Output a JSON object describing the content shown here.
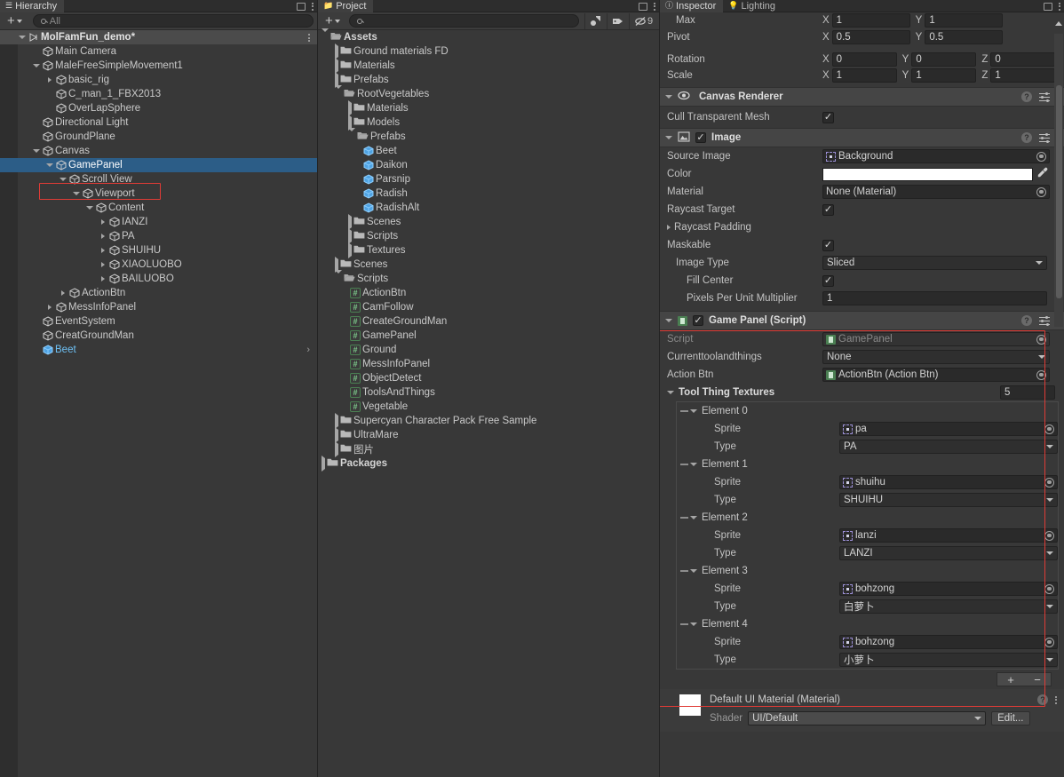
{
  "hierarchy": {
    "tab_label": "Hierarchy",
    "tab_icon": "hierarchy-icon",
    "create_label": "+",
    "search_placeholder": "All",
    "search_value": "",
    "scene_name": "MolFamFun_demo*",
    "items": [
      {
        "label": "Main Camera",
        "depth": 2,
        "tri": "none",
        "icon": "gameobject"
      },
      {
        "label": "MaleFreeSimpleMovement1",
        "depth": 2,
        "tri": "down",
        "icon": "gameobject"
      },
      {
        "label": "basic_rig",
        "depth": 3,
        "tri": "right",
        "icon": "gameobject"
      },
      {
        "label": "C_man_1_FBX2013",
        "depth": 3,
        "tri": "none",
        "icon": "gameobject"
      },
      {
        "label": "OverLapSphere",
        "depth": 3,
        "tri": "none",
        "icon": "gameobject"
      },
      {
        "label": "Directional Light",
        "depth": 2,
        "tri": "none",
        "icon": "gameobject"
      },
      {
        "label": "GroundPlane",
        "depth": 2,
        "tri": "none",
        "icon": "gameobject"
      },
      {
        "label": "Canvas",
        "depth": 2,
        "tri": "down",
        "icon": "gameobject"
      },
      {
        "label": "GamePanel",
        "depth": 3,
        "tri": "down",
        "icon": "gameobject",
        "selected": true
      },
      {
        "label": "Scroll View",
        "depth": 4,
        "tri": "down",
        "icon": "gameobject"
      },
      {
        "label": "Viewport",
        "depth": 5,
        "tri": "down",
        "icon": "gameobject"
      },
      {
        "label": "Content",
        "depth": 6,
        "tri": "down",
        "icon": "gameobject"
      },
      {
        "label": "IANZI",
        "depth": 7,
        "tri": "right",
        "icon": "gameobject"
      },
      {
        "label": "PA",
        "depth": 7,
        "tri": "right",
        "icon": "gameobject"
      },
      {
        "label": "SHUIHU",
        "depth": 7,
        "tri": "right",
        "icon": "gameobject"
      },
      {
        "label": "XIAOLUOBO",
        "depth": 7,
        "tri": "right",
        "icon": "gameobject"
      },
      {
        "label": "BAILUOBO",
        "depth": 7,
        "tri": "right",
        "icon": "gameobject"
      },
      {
        "label": "ActionBtn",
        "depth": 4,
        "tri": "right",
        "icon": "gameobject"
      },
      {
        "label": "MessInfoPanel",
        "depth": 3,
        "tri": "right",
        "icon": "gameobject"
      },
      {
        "label": "EventSystem",
        "depth": 2,
        "tri": "none",
        "icon": "gameobject"
      },
      {
        "label": "CreatGroundMan",
        "depth": 2,
        "tri": "none",
        "icon": "gameobject"
      },
      {
        "label": "Beet",
        "depth": 2,
        "tri": "none",
        "icon": "prefab",
        "prefab": true,
        "arrow": ">"
      }
    ]
  },
  "project": {
    "tab_label": "Project",
    "tab_icon": "folder-icon",
    "create_label": "+",
    "search_placeholder": "",
    "search_value": "",
    "toolbar_icons": [
      "asset-filter-icon",
      "label-filter-icon",
      "hidden-packages-icon"
    ],
    "hidden_count": "9",
    "items": [
      {
        "label": "Assets",
        "depth": 0,
        "tri": "down",
        "icon": "folder-open",
        "bold": true
      },
      {
        "label": "Ground materials FD",
        "depth": 1,
        "tri": "right",
        "icon": "folder"
      },
      {
        "label": "Materials",
        "depth": 1,
        "tri": "right",
        "icon": "folder"
      },
      {
        "label": "Prefabs",
        "depth": 1,
        "tri": "right",
        "icon": "folder"
      },
      {
        "label": "RootVegetables",
        "depth": 1,
        "tri": "down",
        "icon": "folder-open"
      },
      {
        "label": "Materials",
        "depth": 2,
        "tri": "right",
        "icon": "folder"
      },
      {
        "label": "Models",
        "depth": 2,
        "tri": "right",
        "icon": "folder"
      },
      {
        "label": "Prefabs",
        "depth": 2,
        "tri": "down",
        "icon": "folder-open"
      },
      {
        "label": "Beet",
        "depth": 3,
        "tri": "none",
        "icon": "prefab"
      },
      {
        "label": "Daikon",
        "depth": 3,
        "tri": "none",
        "icon": "prefab"
      },
      {
        "label": "Parsnip",
        "depth": 3,
        "tri": "none",
        "icon": "prefab"
      },
      {
        "label": "Radish",
        "depth": 3,
        "tri": "none",
        "icon": "prefab"
      },
      {
        "label": "RadishAlt",
        "depth": 3,
        "tri": "none",
        "icon": "prefab"
      },
      {
        "label": "Scenes",
        "depth": 2,
        "tri": "right",
        "icon": "folder"
      },
      {
        "label": "Scripts",
        "depth": 2,
        "tri": "right",
        "icon": "folder"
      },
      {
        "label": "Textures",
        "depth": 2,
        "tri": "right",
        "icon": "folder"
      },
      {
        "label": "Scenes",
        "depth": 1,
        "tri": "right",
        "icon": "folder"
      },
      {
        "label": "Scripts",
        "depth": 1,
        "tri": "down",
        "icon": "folder-open"
      },
      {
        "label": "ActionBtn",
        "depth": 2,
        "tri": "none",
        "icon": "cs-script"
      },
      {
        "label": "CamFollow",
        "depth": 2,
        "tri": "none",
        "icon": "cs-script"
      },
      {
        "label": "CreateGroundMan",
        "depth": 2,
        "tri": "none",
        "icon": "cs-script"
      },
      {
        "label": "GamePanel",
        "depth": 2,
        "tri": "none",
        "icon": "cs-script"
      },
      {
        "label": "Ground",
        "depth": 2,
        "tri": "none",
        "icon": "cs-script"
      },
      {
        "label": "MessInfoPanel",
        "depth": 2,
        "tri": "none",
        "icon": "cs-script"
      },
      {
        "label": "ObjectDetect",
        "depth": 2,
        "tri": "none",
        "icon": "cs-script"
      },
      {
        "label": "ToolsAndThings",
        "depth": 2,
        "tri": "none",
        "icon": "cs-script"
      },
      {
        "label": "Vegetable",
        "depth": 2,
        "tri": "none",
        "icon": "cs-script"
      },
      {
        "label": "Supercyan Character Pack Free Sample",
        "depth": 1,
        "tri": "right",
        "icon": "folder"
      },
      {
        "label": "UltraMare",
        "depth": 1,
        "tri": "right",
        "icon": "folder"
      },
      {
        "label": "图片",
        "depth": 1,
        "tri": "right",
        "icon": "folder"
      },
      {
        "label": "Packages",
        "depth": 0,
        "tri": "right",
        "icon": "folder",
        "bold": true
      }
    ]
  },
  "inspector": {
    "tabs": [
      {
        "label": "Inspector",
        "icon": "info-icon",
        "active": true
      },
      {
        "label": "Lighting",
        "icon": "bulb-icon",
        "active": false
      }
    ],
    "rect_transform": {
      "rows": [
        {
          "name": "Max",
          "fields": [
            {
              "axis": "X",
              "value": "1"
            },
            {
              "axis": "Y",
              "value": "1"
            }
          ],
          "kind": "xy"
        },
        {
          "name": "Pivot",
          "fields": [
            {
              "axis": "X",
              "value": "0.5"
            },
            {
              "axis": "Y",
              "value": "0.5"
            }
          ],
          "kind": "xy"
        },
        {
          "name": "Rotation",
          "fields": [
            {
              "axis": "X",
              "value": "0"
            },
            {
              "axis": "Y",
              "value": "0"
            },
            {
              "axis": "Z",
              "value": "0"
            }
          ],
          "kind": "xyz"
        },
        {
          "name": "Scale",
          "fields": [
            {
              "axis": "X",
              "value": "1"
            },
            {
              "axis": "Y",
              "value": "1"
            },
            {
              "axis": "Z",
              "value": "1"
            }
          ],
          "kind": "xyz"
        }
      ]
    },
    "canvas_renderer": {
      "title": "Canvas Renderer",
      "icon": "eye-icon",
      "cull_label": "Cull Transparent Mesh",
      "cull_checked": true
    },
    "image": {
      "title": "Image",
      "icon": "image-icon",
      "enabled": true,
      "source_image_label": "Source Image",
      "source_image_value": "Background",
      "color_label": "Color",
      "color_value": "#FFFFFF",
      "material_label": "Material",
      "material_value": "None (Material)",
      "raycast_target_label": "Raycast Target",
      "raycast_target_checked": true,
      "raycast_padding_label": "Raycast Padding",
      "maskable_label": "Maskable",
      "maskable_checked": true,
      "image_type_label": "Image Type",
      "image_type_value": "Sliced",
      "fill_center_label": "Fill Center",
      "fill_center_checked": true,
      "pixels_label": "Pixels Per Unit Multiplier",
      "pixels_value": "1"
    },
    "game_panel": {
      "title": "Game Panel (Script)",
      "icon": "cs-script-icon",
      "enabled": true,
      "script_label": "Script",
      "script_value": "GamePanel",
      "current_label": "Currenttoolandthings",
      "current_value": "None",
      "action_btn_label": "Action Btn",
      "action_btn_value": "ActionBtn (Action Btn)",
      "array_label": "Tool Thing Textures",
      "array_size": "5",
      "sprite_label": "Sprite",
      "type_label": "Type",
      "elements": [
        {
          "name": "Element 0",
          "sprite": "pa",
          "type": "PA"
        },
        {
          "name": "Element 1",
          "sprite": "shuihu",
          "type": "SHUIHU"
        },
        {
          "name": "Element 2",
          "sprite": "lanzi",
          "type": "LANZI"
        },
        {
          "name": "Element 3",
          "sprite": "bohzong",
          "type": "白萝卜"
        },
        {
          "name": "Element 4",
          "sprite": "bohzong",
          "type": "小萝卜"
        }
      ],
      "add_label": "+",
      "remove_label": "−"
    },
    "material": {
      "title": "Default UI Material (Material)",
      "shader_label": "Shader",
      "shader_value": "UI/Default",
      "edit_label": "Edit...",
      "swatch_color": "#FFFFFF"
    }
  },
  "theme": {
    "panel_bg": "#383838",
    "header_bg": "#454545",
    "selection_blue": "#2c5d87",
    "highlight_red": "#e03b36",
    "prefab_blue": "#6ec1f5",
    "script_green": "#4a7f52"
  }
}
